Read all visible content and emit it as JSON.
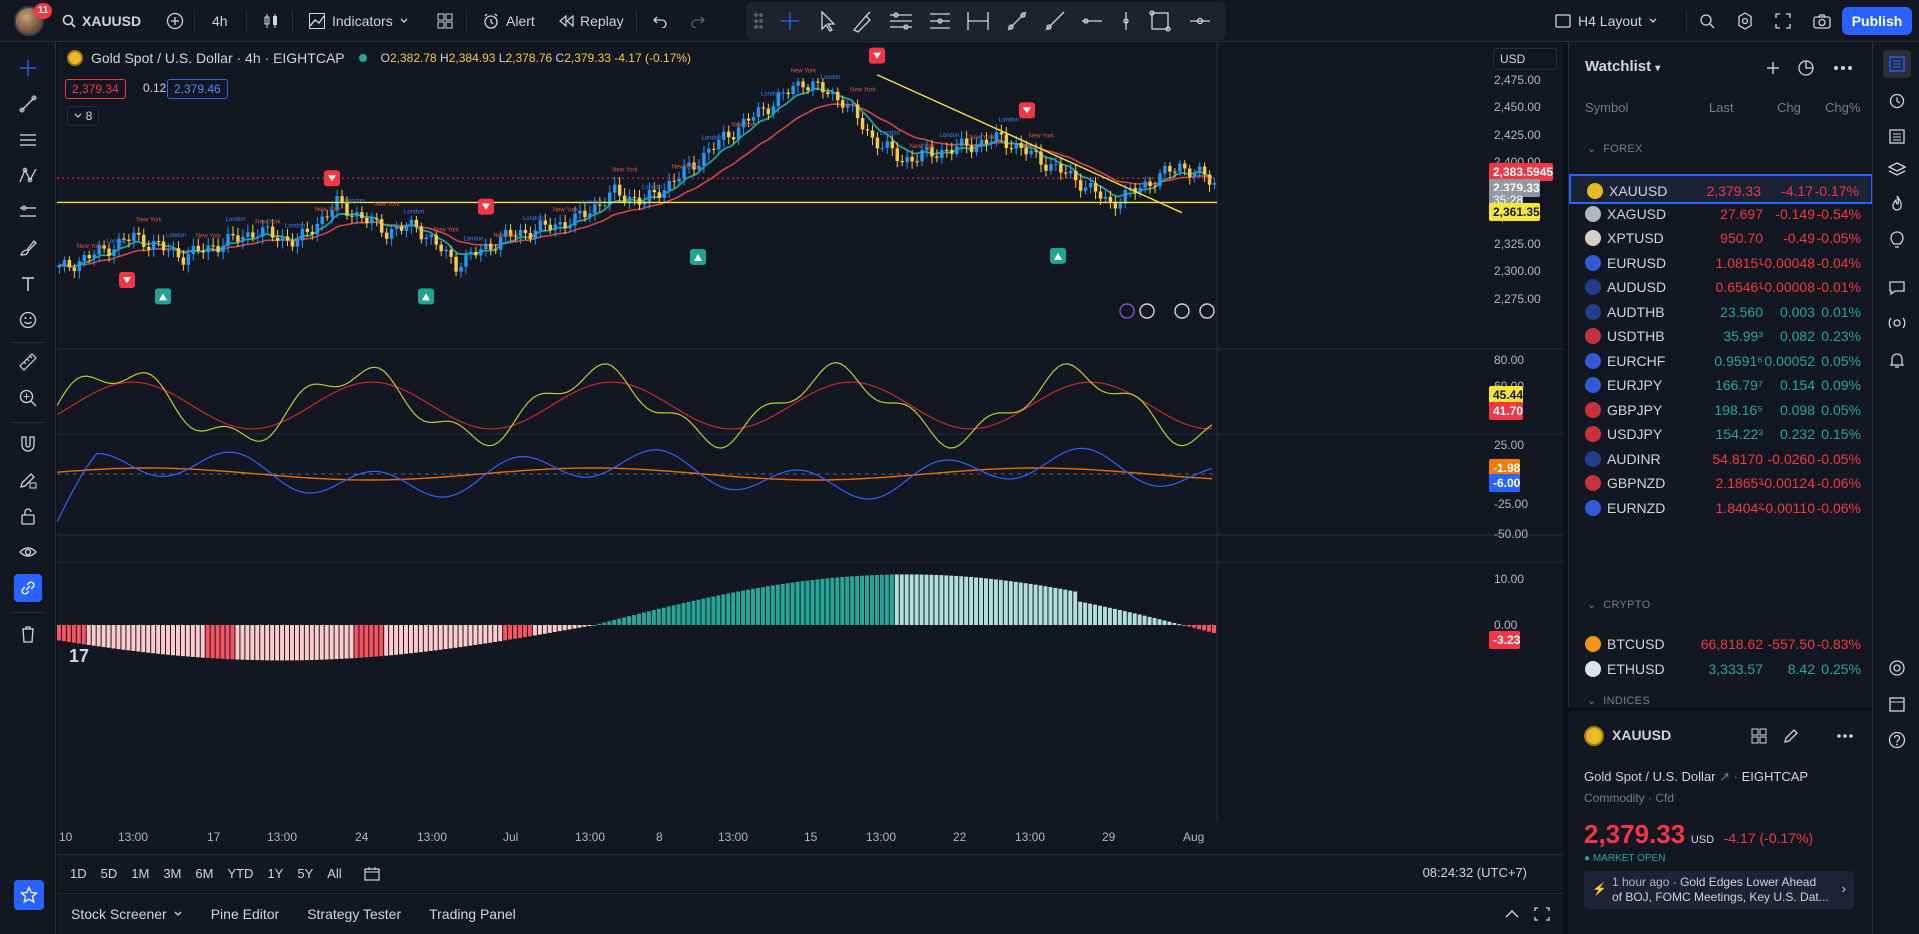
{
  "topbar": {
    "notification_count": "11",
    "symbol": "XAUUSD",
    "interval": "4h",
    "indicators_label": "Indicators",
    "alert_label": "Alert",
    "replay_label": "Replay",
    "layout_label": "H4 Layout",
    "publish_label": "Publish"
  },
  "chart": {
    "title": "Gold Spot / U.S. Dollar · 4h · EIGHTCAP",
    "ohlc": {
      "o_label": "O",
      "o": "2,382.78",
      "h_label": "H",
      "h": "2,384.93",
      "l_label": "L",
      "l": "2,378.76",
      "c_label": "C",
      "c": "2,379.33",
      "change": "-4.17 (-0.17%)"
    },
    "sell_price": "2,379.34",
    "spread": "0.12",
    "buy_price": "2,379.46",
    "indicator_count": "8",
    "currency": "USD",
    "price_axis": [
      "2,475.00",
      "2,450.00",
      "2,425.00",
      "2,400.00",
      "2,350.00",
      "2,325.00",
      "2,300.00",
      "2,275.00"
    ],
    "price_tags": {
      "high_line": "2,383.5945",
      "last": "2,379.33",
      "countdown": "35:28",
      "support": "2,361.35"
    },
    "osc1_axis": [
      "80.00",
      "60.00"
    ],
    "osc1_tags": {
      "a": "45.44",
      "b": "41.70"
    },
    "osc2_axis": [
      "25.00",
      "-25.00",
      "-50.00"
    ],
    "osc2_tags": {
      "a": "-1.98",
      "b": "-6.00"
    },
    "hist_axis": [
      "10.00",
      "0.00"
    ],
    "hist_tag": "-3.23",
    "time_axis": [
      "10",
      "13:00",
      "17",
      "13:00",
      "24",
      "13:00",
      "Jul",
      "13:00",
      "8",
      "13:00",
      "15",
      "13:00",
      "22",
      "13:00",
      "29",
      "Aug"
    ],
    "session_labels": {
      "ny": "New York",
      "london": "London"
    }
  },
  "range_bar": {
    "ranges": [
      "1D",
      "5D",
      "1M",
      "3M",
      "6M",
      "YTD",
      "1Y",
      "5Y",
      "All"
    ],
    "clock": "08:24:32 (UTC+7)"
  },
  "bottom_tabs": [
    "Stock Screener",
    "Pine Editor",
    "Strategy Tester",
    "Trading Panel"
  ],
  "watchlist": {
    "title": "Watchlist",
    "columns": {
      "symbol": "Symbol",
      "last": "Last",
      "chg": "Chg",
      "chgp": "Chg%"
    },
    "groups": {
      "forex": "FOREX",
      "crypto": "CRYPTO",
      "indices": "INDICES"
    },
    "forex": [
      {
        "symbol": "XAUUSD",
        "last": "2,379.33",
        "chg": "-4.17",
        "chgp": "-0.17%",
        "dir": "down",
        "flag": "#e8b923"
      },
      {
        "symbol": "XAGUSD",
        "last": "27.697",
        "chg": "-0.149",
        "chgp": "-0.54%",
        "dir": "down",
        "flag": "#b2b5be"
      },
      {
        "symbol": "XPTUSD",
        "last": "950.70",
        "chg": "-0.49",
        "chgp": "-0.05%",
        "dir": "down",
        "flag": "#d6cfc2"
      },
      {
        "symbol": "EURUSD",
        "last": "1.0815¹",
        "chg": "-0.00048",
        "chgp": "-0.04%",
        "dir": "down",
        "flag": "#2f5cd6"
      },
      {
        "symbol": "AUDUSD",
        "last": "0.6546¹",
        "chg": "-0.00008",
        "chgp": "-0.01%",
        "dir": "down",
        "flag": "#233d8c"
      },
      {
        "symbol": "AUDTHB",
        "last": "23.560",
        "chg": "0.003",
        "chgp": "0.01%",
        "dir": "up",
        "flag": "#233d8c"
      },
      {
        "symbol": "USDTHB",
        "last": "35.99³",
        "chg": "0.082",
        "chgp": "0.23%",
        "dir": "up",
        "flag": "#c8313b"
      },
      {
        "symbol": "EURCHF",
        "last": "0.9591⁶",
        "chg": "0.00052",
        "chgp": "0.05%",
        "dir": "up",
        "flag": "#2f5cd6"
      },
      {
        "symbol": "EURJPY",
        "last": "166.79⁷",
        "chg": "0.154",
        "chgp": "0.09%",
        "dir": "up",
        "flag": "#2f5cd6"
      },
      {
        "symbol": "GBPJPY",
        "last": "198.16⁵",
        "chg": "0.098",
        "chgp": "0.05%",
        "dir": "up",
        "flag": "#c8313b"
      },
      {
        "symbol": "USDJPY",
        "last": "154.22³",
        "chg": "0.232",
        "chgp": "0.15%",
        "dir": "up",
        "flag": "#c8313b"
      },
      {
        "symbol": "AUDINR",
        "last": "54.8170",
        "chg": "-0.0260",
        "chgp": "-0.05%",
        "dir": "down",
        "flag": "#233d8c"
      },
      {
        "symbol": "GBPNZD",
        "last": "2.1865³",
        "chg": "-0.00124",
        "chgp": "-0.06%",
        "dir": "down",
        "flag": "#c8313b"
      },
      {
        "symbol": "EURNZD",
        "last": "1.8404²",
        "chg": "-0.00110",
        "chgp": "-0.06%",
        "dir": "down",
        "flag": "#2f5cd6"
      }
    ],
    "crypto": [
      {
        "symbol": "BTCUSD",
        "last": "66,818.62",
        "chg": "-557.50",
        "chgp": "-0.83%",
        "dir": "down",
        "flag": "#f7931a"
      },
      {
        "symbol": "ETHUSD",
        "last": "3,333.57",
        "chg": "8.42",
        "chgp": "0.25%",
        "dir": "up",
        "flag": "#dfe3ee"
      }
    ]
  },
  "details": {
    "symbol": "XAUUSD",
    "description": "Gold Spot / U.S. Dollar",
    "exchange": "EIGHTCAP",
    "category": "Commodity",
    "type": "Cfd",
    "price": "2,379.33",
    "currency": "USD",
    "change": "-4.17 (-0.17%)",
    "status": "MARKET OPEN",
    "news_time": "1 hour ago",
    "news_line1": "Gold Edges Lower Ahead",
    "news_line2": "of BOJ, FOMC Meetings, Key U.S. Dat..."
  },
  "colors": {
    "bg": "#131722",
    "up": "#26a69a",
    "down": "#f23645",
    "accent": "#2962ff",
    "candle_up": "#2196f3",
    "candle_down": "#f7c948"
  }
}
